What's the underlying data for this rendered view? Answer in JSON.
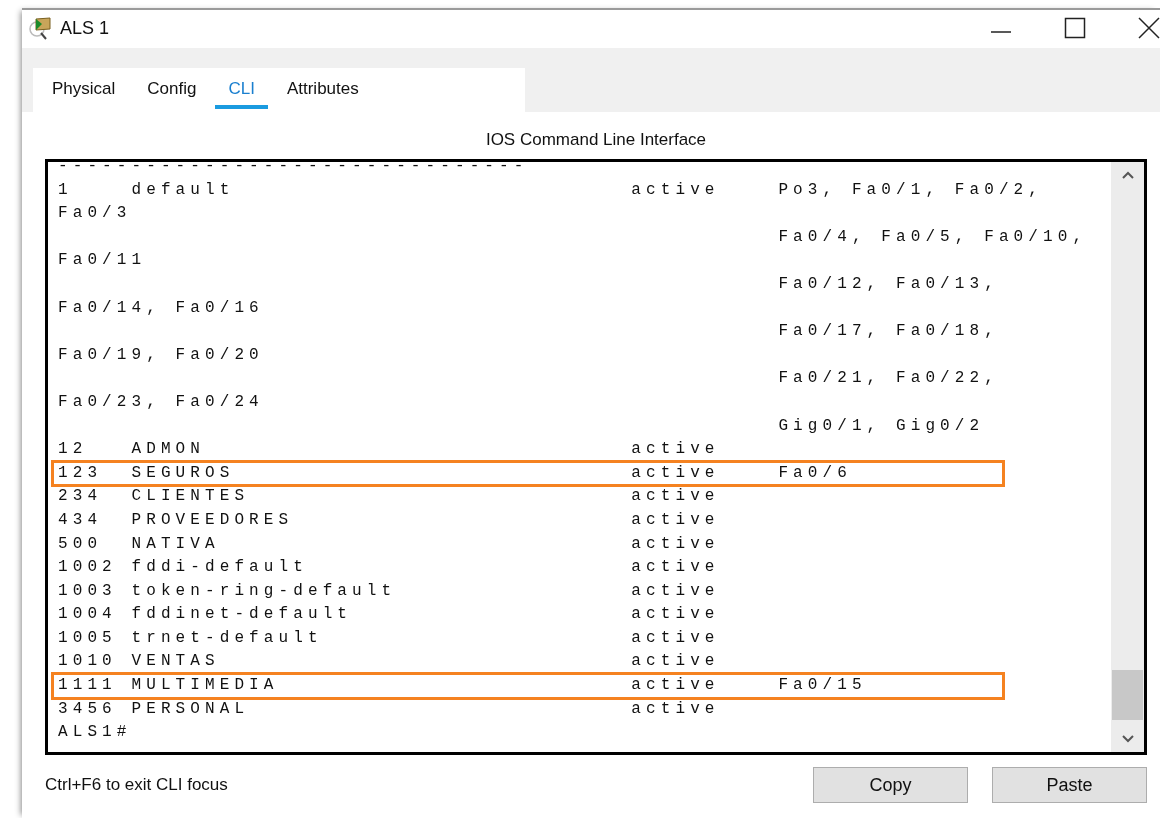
{
  "window": {
    "title": "ALS 1"
  },
  "tabs": [
    {
      "label": "Physical",
      "selected": false
    },
    {
      "label": "Config",
      "selected": false
    },
    {
      "label": "CLI",
      "selected": true
    },
    {
      "label": "Attributes",
      "selected": false
    }
  ],
  "cli": {
    "title": "IOS Command Line Interface",
    "lines": [
      {
        "text": "--------------------------------",
        "highlighted": false
      },
      {
        "text": "1    default                           active    Po3, Fa0/1, Fa0/2,",
        "highlighted": false
      },
      {
        "text": "Fa0/3",
        "highlighted": false
      },
      {
        "text": "                                                 Fa0/4, Fa0/5, Fa0/10,",
        "highlighted": false
      },
      {
        "text": "Fa0/11",
        "highlighted": false
      },
      {
        "text": "                                                 Fa0/12, Fa0/13,",
        "highlighted": false
      },
      {
        "text": "Fa0/14, Fa0/16",
        "highlighted": false
      },
      {
        "text": "                                                 Fa0/17, Fa0/18,",
        "highlighted": false
      },
      {
        "text": "Fa0/19, Fa0/20",
        "highlighted": false
      },
      {
        "text": "                                                 Fa0/21, Fa0/22,",
        "highlighted": false
      },
      {
        "text": "Fa0/23, Fa0/24",
        "highlighted": false
      },
      {
        "text": "                                                 Gig0/1, Gig0/2",
        "highlighted": false
      },
      {
        "text": "12   ADMON                             active",
        "highlighted": false
      },
      {
        "text": "123  SEGUROS                           active    Fa0/6",
        "highlighted": true
      },
      {
        "text": "234  CLIENTES                          active",
        "highlighted": false
      },
      {
        "text": "434  PROVEEDORES                       active",
        "highlighted": false
      },
      {
        "text": "500  NATIVA                            active",
        "highlighted": false
      },
      {
        "text": "1002 fddi-default                      active",
        "highlighted": false
      },
      {
        "text": "1003 token-ring-default                active",
        "highlighted": false
      },
      {
        "text": "1004 fddinet-default                   active",
        "highlighted": false
      },
      {
        "text": "1005 trnet-default                     active",
        "highlighted": false
      },
      {
        "text": "1010 VENTAS                            active",
        "highlighted": false
      },
      {
        "text": "1111 MULTIMEDIA                        active    Fa0/15",
        "highlighted": true
      },
      {
        "text": "3456 PERSONAL                          active",
        "highlighted": false
      },
      {
        "text": "ALS1#",
        "highlighted": false
      }
    ]
  },
  "footer": {
    "hint": "Ctrl+F6 to exit CLI focus",
    "buttons": [
      "Copy",
      "Paste"
    ]
  }
}
